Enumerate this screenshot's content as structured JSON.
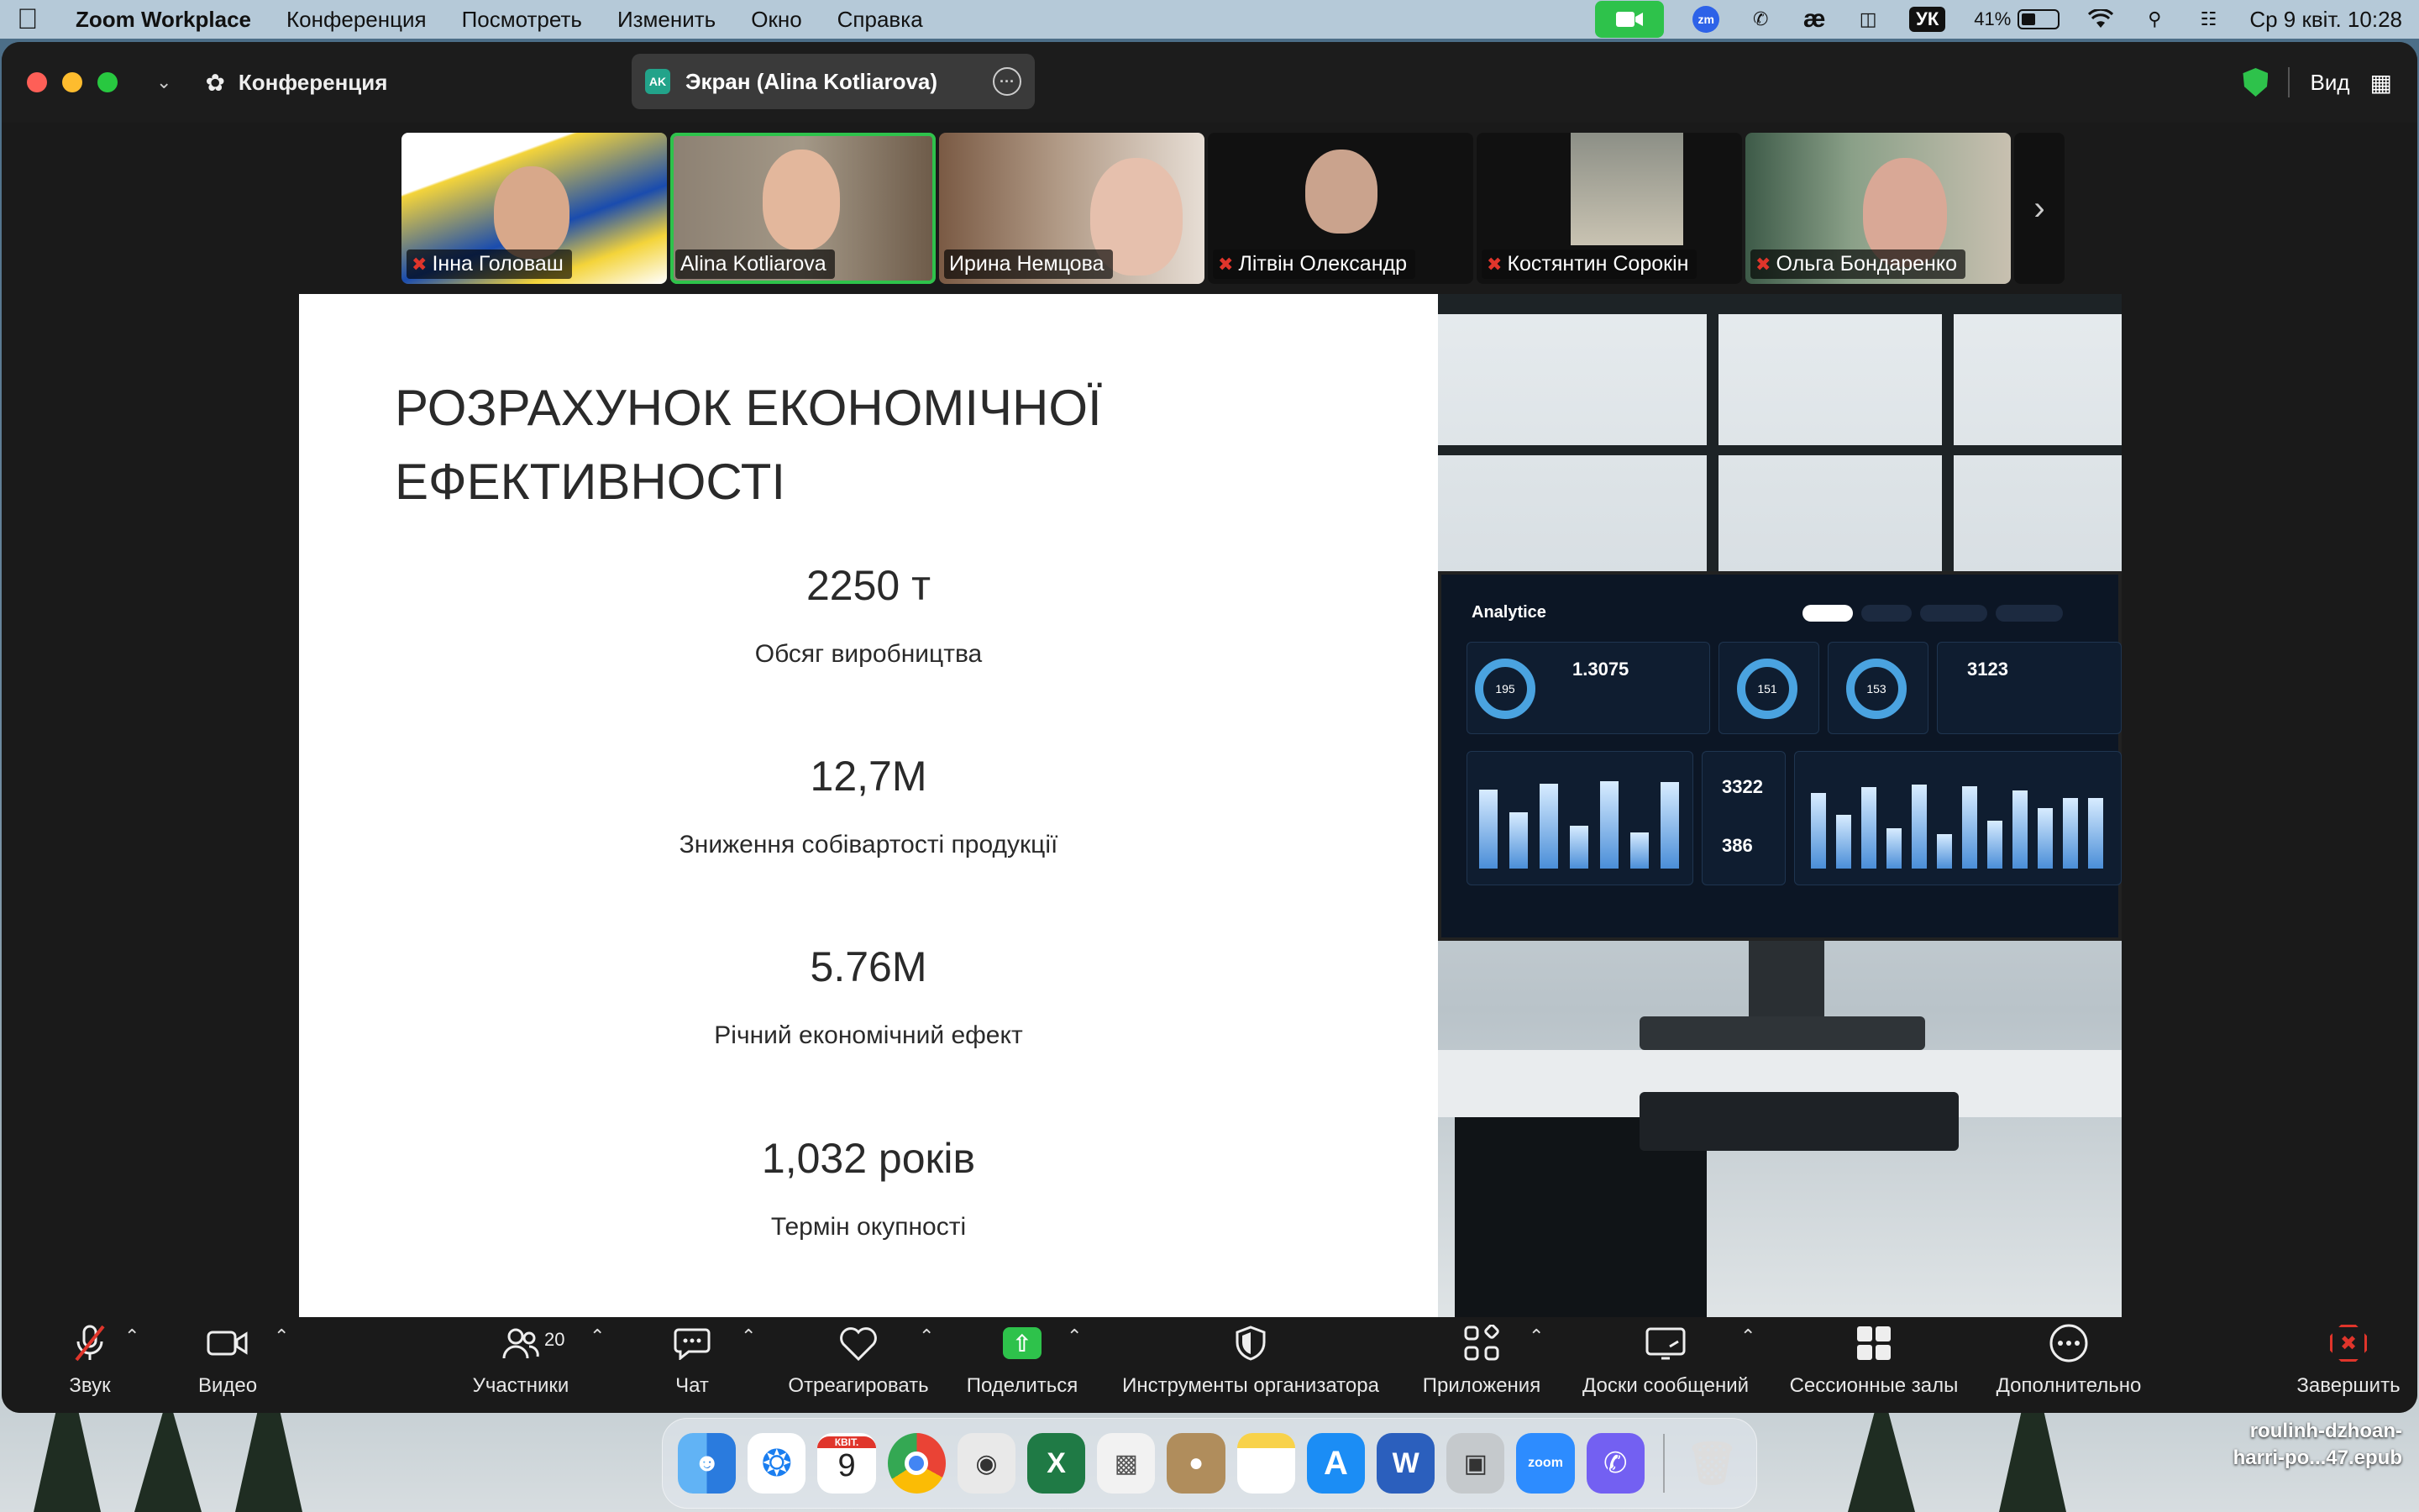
{
  "menubar": {
    "app_name": "Zoom Workplace",
    "items": [
      "Конференция",
      "Посмотреть",
      "Изменить",
      "Окно",
      "Справка"
    ],
    "lang": "УК",
    "battery": "41%",
    "battery_level": 0.41,
    "datetime": "Ср 9 квіт.  10:28"
  },
  "window": {
    "title": "Конференция",
    "share_tab_badge": "AK",
    "share_tab_label": "Экран (Alina Kotliarova)",
    "view_label": "Вид"
  },
  "participants": [
    {
      "name": "Інна Головаш",
      "muted": true,
      "active": false
    },
    {
      "name": "Alina Kotliarova",
      "muted": false,
      "active": true
    },
    {
      "name": "Ирина Немцова",
      "muted": false,
      "active": false
    },
    {
      "name": "Літвін Олександр",
      "muted": true,
      "active": false
    },
    {
      "name": "Костянтин Сорокін",
      "muted": true,
      "active": false
    },
    {
      "name": "Ольга Бондаренко",
      "muted": true,
      "active": false
    }
  ],
  "slide": {
    "title_line1": "РОЗРАХУНОК ЕКОНОМІЧНОЇ",
    "title_line2": "ЕФЕКТИВНОСТІ",
    "metrics": [
      {
        "value": "2250 т",
        "label": "Обсяг виробництва"
      },
      {
        "value": "12,7М",
        "label": "Зниження собівартості продукції"
      },
      {
        "value": "5.76М",
        "label": "Річний економічний ефект"
      },
      {
        "value": "1,032 років",
        "label": "Термін окупності"
      }
    ],
    "dashboard": {
      "title": "Analytice",
      "ring_values": [
        "195",
        "151",
        "153"
      ],
      "numbers": [
        "1.3075",
        "3123",
        "3322",
        "386"
      ]
    }
  },
  "controls": {
    "audio": "Звук",
    "video": "Видео",
    "participants": "Участники",
    "participants_count": "20",
    "chat": "Чат",
    "react": "Отреагировать",
    "share": "Поделиться",
    "host_tools": "Инструменты организатора",
    "apps": "Приложения",
    "whiteboards": "Доски сообщений",
    "breakout": "Сессионные залы",
    "more": "Дополнительно",
    "end": "Завершить"
  },
  "dock": {
    "calendar_month": "КВІТ.",
    "calendar_day": "9",
    "zoom_label": "zoom"
  },
  "desktop_file": {
    "line1": "roulinh-dzhoan-",
    "line2": "harri-po...47.epub"
  },
  "colors": {
    "accent_green": "#2ec24b",
    "end_red": "#e0352b",
    "window_bg": "#1a1a1a"
  }
}
